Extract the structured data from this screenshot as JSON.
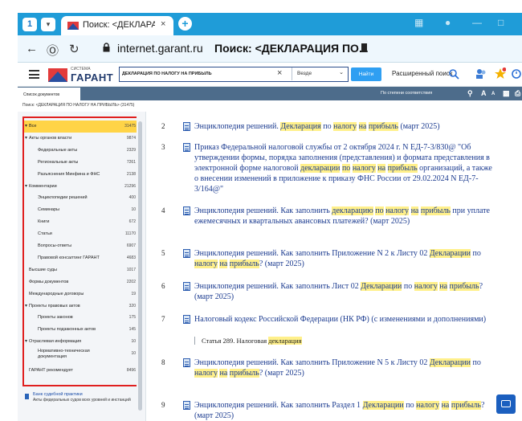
{
  "browser": {
    "tab_badge": "1",
    "tab_title": "Поиск: <ДЕКЛАРАЦИЯ",
    "tab_close": "×",
    "new_tab": "+",
    "url": "internet.garant.ru",
    "page_title": "Поиск: <ДЕКЛАРАЦИЯ ПО..."
  },
  "app": {
    "logo_sub": "СИСТЕМА",
    "logo_text": "ГАРАНТ",
    "search_value": "ДЕКЛАРАЦИЯ ПО НАЛОГУ НА ПРИБЫЛЬ",
    "search_scope": "Везде",
    "search_button": "Найти",
    "advanced_search": "Расширенный поиск"
  },
  "toolbar": {
    "doc_list_tab": "Список документов",
    "sort_label": "По степени соответствия",
    "font_a_big": "A",
    "font_a_small": "A"
  },
  "breadcrumb": "Поиск: <ДЕКЛАРАЦИЯ ПО НАЛОГУ НА ПРИБЫЛЬ> (31475)",
  "tree": [
    {
      "label": "Все",
      "count": "31475",
      "level": 0,
      "expanded": true,
      "active": true
    },
    {
      "label": "Акты органов власти",
      "count": "9874",
      "level": 1,
      "expanded": true
    },
    {
      "label": "Федеральные акты",
      "count": "2329",
      "level": 2
    },
    {
      "label": "Региональные акты",
      "count": "7261",
      "level": 2
    },
    {
      "label": "Разъяснения Минфина и ФНС",
      "count": "2138",
      "level": 2
    },
    {
      "label": "Комментарии",
      "count": "21296",
      "level": 1,
      "expanded": true
    },
    {
      "label": "Энциклопедии решений",
      "count": "400",
      "level": 2
    },
    {
      "label": "Семинары",
      "count": "10",
      "level": 2
    },
    {
      "label": "Книги",
      "count": "672",
      "level": 2
    },
    {
      "label": "Статьи",
      "count": "11170",
      "level": 2
    },
    {
      "label": "Вопросы-ответы",
      "count": "6907",
      "level": 2
    },
    {
      "label": "Правовой консалтинг ГАРАНТ",
      "count": "4683",
      "level": 2
    },
    {
      "label": "Высшие суды",
      "count": "1017",
      "level": 0
    },
    {
      "label": "Формы документов",
      "count": "2202",
      "level": 0
    },
    {
      "label": "Международные договоры",
      "count": "19",
      "level": 0
    },
    {
      "label": "Проекты правовых актов",
      "count": "320",
      "level": 1,
      "expanded": true
    },
    {
      "label": "Проекты законов",
      "count": "175",
      "level": 2
    },
    {
      "label": "Проекты подзаконных актов",
      "count": "145",
      "level": 2
    },
    {
      "label": "Отраслевая информация",
      "count": "10",
      "level": 1,
      "expanded": true
    },
    {
      "label": "Нормативно-техническая документация",
      "count": "10",
      "level": 2,
      "two_line": true
    },
    {
      "label": "ГАРАНТ рекомендует",
      "count": "8496",
      "level": 0
    }
  ],
  "side_extra": {
    "title": "Банк судебной практики",
    "subtitle": "Акты федеральных судов всех уровней и инстанций"
  },
  "results": [
    {
      "num": "2",
      "parts": [
        {
          "t": "Энциклопедия решений. "
        },
        {
          "t": "Декларация",
          "h": true
        },
        {
          "t": " по "
        },
        {
          "t": "налогу",
          "h": true
        },
        {
          "t": " "
        },
        {
          "t": "на",
          "h": true
        },
        {
          "t": " "
        },
        {
          "t": "прибыль",
          "h": true
        },
        {
          "t": " (март 2025)"
        }
      ]
    },
    {
      "num": "3",
      "parts": [
        {
          "t": "Приказ Федеральной налоговой службы от 2 октября 2024 г. N ЕД-7-3/830@ \"Об утверждении формы, порядка заполнения (представления) и формата представления в электронной форме налоговой "
        },
        {
          "t": "декларации",
          "h": true
        },
        {
          "t": " "
        },
        {
          "t": "по",
          "h": true
        },
        {
          "t": " "
        },
        {
          "t": "налогу",
          "h": true
        },
        {
          "t": " "
        },
        {
          "t": "на",
          "h": true
        },
        {
          "t": " "
        },
        {
          "t": "прибыль",
          "h": true
        },
        {
          "t": " организаций, а также о внесении изменений в приложение к приказу ФНС России от 29.02.2024 N ЕД-7-3/164@\""
        }
      ]
    },
    {
      "num": "4",
      "parts": [
        {
          "t": "Энциклопедия решений. Как заполнить "
        },
        {
          "t": "декларацию",
          "h": true
        },
        {
          "t": " "
        },
        {
          "t": "по",
          "h": true
        },
        {
          "t": " "
        },
        {
          "t": "налогу",
          "h": true
        },
        {
          "t": " "
        },
        {
          "t": "на",
          "h": true
        },
        {
          "t": " "
        },
        {
          "t": "прибыль",
          "h": true
        },
        {
          "t": " при уплате ежемесячных и квартальных авансовых платежей? (март 2025)"
        }
      ]
    },
    {
      "num": "5",
      "parts": [
        {
          "t": "Энциклопедия решений. Как заполнить Приложение N 2 к Листу 02 "
        },
        {
          "t": "Декларации",
          "h": true
        },
        {
          "t": " по "
        },
        {
          "t": "налогу",
          "h": true
        },
        {
          "t": " "
        },
        {
          "t": "на",
          "h": true
        },
        {
          "t": " "
        },
        {
          "t": "прибыль",
          "h": true
        },
        {
          "t": "? (март 2025)"
        }
      ]
    },
    {
      "num": "6",
      "parts": [
        {
          "t": "Энциклопедия решений. Как заполнить Лист 02 "
        },
        {
          "t": "Декларации",
          "h": true
        },
        {
          "t": " по "
        },
        {
          "t": "налогу",
          "h": true
        },
        {
          "t": " "
        },
        {
          "t": "на",
          "h": true
        },
        {
          "t": " "
        },
        {
          "t": "прибыль",
          "h": true
        },
        {
          "t": "? (март 2025)"
        }
      ]
    },
    {
      "num": "7",
      "parts": [
        {
          "t": "Налоговый кодекс Российской Федерации (НК РФ) (с изменениями и дополнениями)"
        }
      ],
      "sub": [
        {
          "t": "Статья 289. Налоговая "
        },
        {
          "t": "декларация",
          "h": true
        }
      ]
    },
    {
      "num": "8",
      "parts": [
        {
          "t": "Энциклопедия решений. Как заполнить Приложение N 5 к Листу 02 "
        },
        {
          "t": "Декларации",
          "h": true
        },
        {
          "t": " по "
        },
        {
          "t": "налогу",
          "h": true
        },
        {
          "t": " "
        },
        {
          "t": "на",
          "h": true
        },
        {
          "t": " "
        },
        {
          "t": "прибыль",
          "h": true
        },
        {
          "t": "? (март 2025)"
        }
      ]
    },
    {
      "num": "9",
      "parts": [
        {
          "t": "Энциклопедия решений. Как заполнить Раздел 1 "
        },
        {
          "t": "Декларации",
          "h": true
        },
        {
          "t": " по "
        },
        {
          "t": "налогу",
          "h": true
        },
        {
          "t": " "
        },
        {
          "t": "на",
          "h": true
        },
        {
          "t": " "
        },
        {
          "t": "прибыль",
          "h": true
        },
        {
          "t": "? (март 2025)"
        }
      ]
    }
  ],
  "colors": {
    "tab_bar": "#1f9cd8",
    "highlight": "#fff08a",
    "tree_active": "#ffd447",
    "tree_frame": "#e01f1f",
    "link": "#1a3a8f",
    "search_button": "#2f9ff2"
  },
  "icons": [
    "menu-icon",
    "back-icon",
    "forward-icon",
    "reload-icon",
    "lock-icon",
    "bookmark-icon",
    "clear-icon",
    "chevron-down-icon",
    "document-icon",
    "help-chat-icon"
  ]
}
